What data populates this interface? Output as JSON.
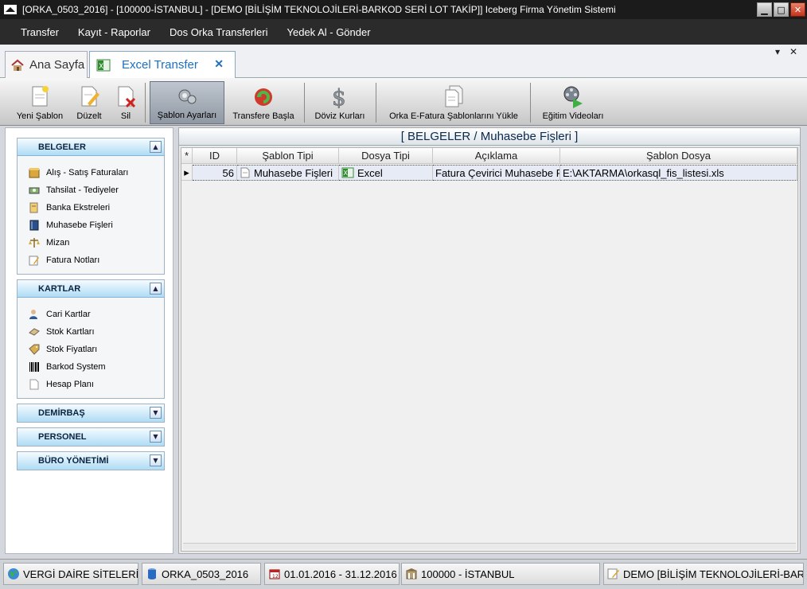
{
  "window": {
    "title": "[ORKA_0503_2016]  -  [100000-İSTANBUL]  -  [DEMO [BİLİŞİM TEKNOLOJİLERİ-BARKOD SERİ LOT TAKİP]]     Iceberg Firma Yönetim Sistemi"
  },
  "menu": [
    "Transfer",
    "Kayıt - Raporlar",
    "Dos Orka Transferleri",
    "Yedek Al - Gönder"
  ],
  "tabs": {
    "home": "Ana Sayfa",
    "active": "Excel Transfer"
  },
  "toolbar": {
    "new": "Yeni Şablon",
    "edit": "Düzelt",
    "delete": "Sil",
    "settings": "Şablon Ayarları",
    "start": "Transfere Başla",
    "fx": "Döviz Kurları",
    "efatura": "Orka E-Fatura Şablonlarını Yükle",
    "videos": "Eğitim Videoları"
  },
  "sidebar": {
    "groups": [
      {
        "title": "BELGELER",
        "items": [
          "Alış - Satış Faturaları",
          "Tahsilat - Tediyeler",
          "Banka Ekstreleri",
          "Muhasebe Fişleri",
          "Mizan",
          "Fatura Notları"
        ]
      },
      {
        "title": "KARTLAR",
        "items": [
          "Cari Kartlar",
          "Stok Kartları",
          "Stok Fiyatları",
          "Barkod System",
          "Hesap Planı"
        ]
      },
      {
        "title": "DEMİRBAŞ",
        "items": []
      },
      {
        "title": "PERSONEL",
        "items": []
      },
      {
        "title": "BÜRO YÖNETİMİ",
        "items": []
      }
    ]
  },
  "grid": {
    "title": "[ BELGELER / Muhasebe Fişleri ]",
    "headers": {
      "marker": "*",
      "id": "ID",
      "tip": "Şablon Tipi",
      "dosya": "Dosya Tipi",
      "aciklama": "Açıklama",
      "sablon": "Şablon Dosya"
    },
    "rows": [
      {
        "id": "56",
        "tip": "Muhasebe Fişleri",
        "dosya": "Excel",
        "aciklama": "Fatura Çevirici Muhasebe F",
        "sablon": "E:\\AKTARMA\\orkasql_fis_listesi.xls"
      }
    ]
  },
  "status": {
    "vergi": "VERGİ DAİRE SİTELERİ",
    "db": "ORKA_0503_2016",
    "period": "01.01.2016 - 31.12.2016",
    "branch": "100000 - İSTANBUL",
    "company": "DEMO [BİLİŞİM TEKNOLOJİLERİ-BARKOD SERİ LOT TAKİP]"
  }
}
